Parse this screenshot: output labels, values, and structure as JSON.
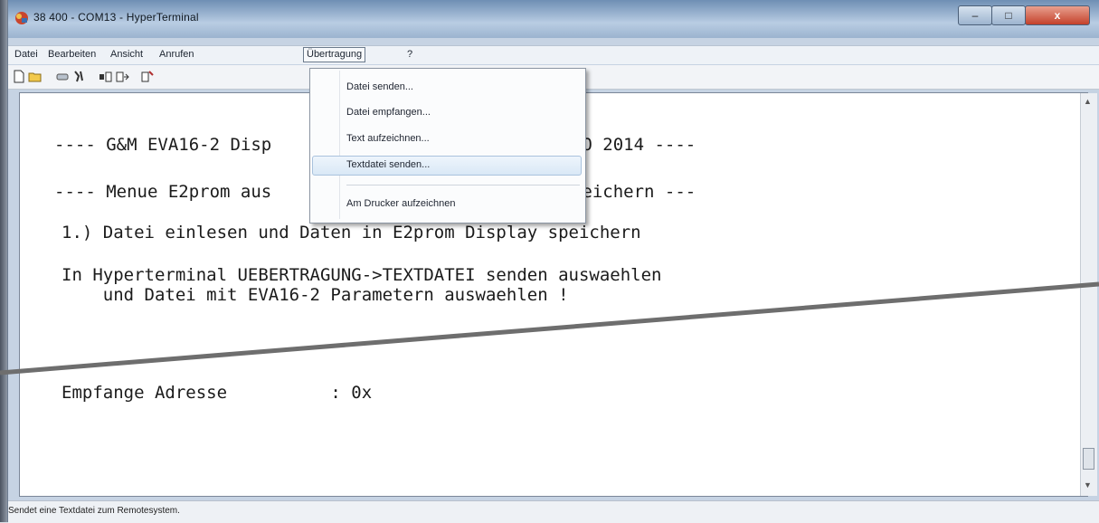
{
  "window": {
    "title": "38 400 - COM13 - HyperTerminal",
    "controls": {
      "minimize": "–",
      "maximize": "□",
      "close": "x"
    }
  },
  "menubar": {
    "items": [
      "Datei",
      "Bearbeiten",
      "Ansicht",
      "Anrufen",
      "Übertragung",
      "?"
    ],
    "active_index": 4
  },
  "toolbar": {
    "icons": [
      "new-icon",
      "open-icon",
      "disconnect-icon",
      "dial-icon",
      "send-icon",
      "receive-icon",
      "properties-icon"
    ]
  },
  "dropdown": {
    "items": [
      "Datei senden...",
      "Datei empfangen...",
      "Text aufzeichnen...",
      "Textdatei senden...",
      "Am Drucker aufzeichnen"
    ],
    "highlighted_index": 3
  },
  "terminal": {
    "lines": [
      "---- G&M EVA16-2 Disp                   3 <C> G&M/NO 2014 ----",
      "---- Menue E2prom aus                   i zurueckspeichern ---",
      "1.) Datei einlesen und Daten in E2prom Display speichern",
      "In Hyperterminal UEBERTRAGUNG->TEXTDATEI senden auswaehlen",
      "    und Datei mit EVA16-2 Parametern auswaehlen !",
      "Empfange Adresse          : 0x"
    ]
  },
  "statusbar": {
    "text": "Sendet eine Textdatei zum Remotesystem."
  },
  "colors": {
    "titlebar": "#9fb7d3",
    "close_button": "#c4412a",
    "terminal_bg": "#ffffff",
    "highlight": "#d9e8f6"
  }
}
